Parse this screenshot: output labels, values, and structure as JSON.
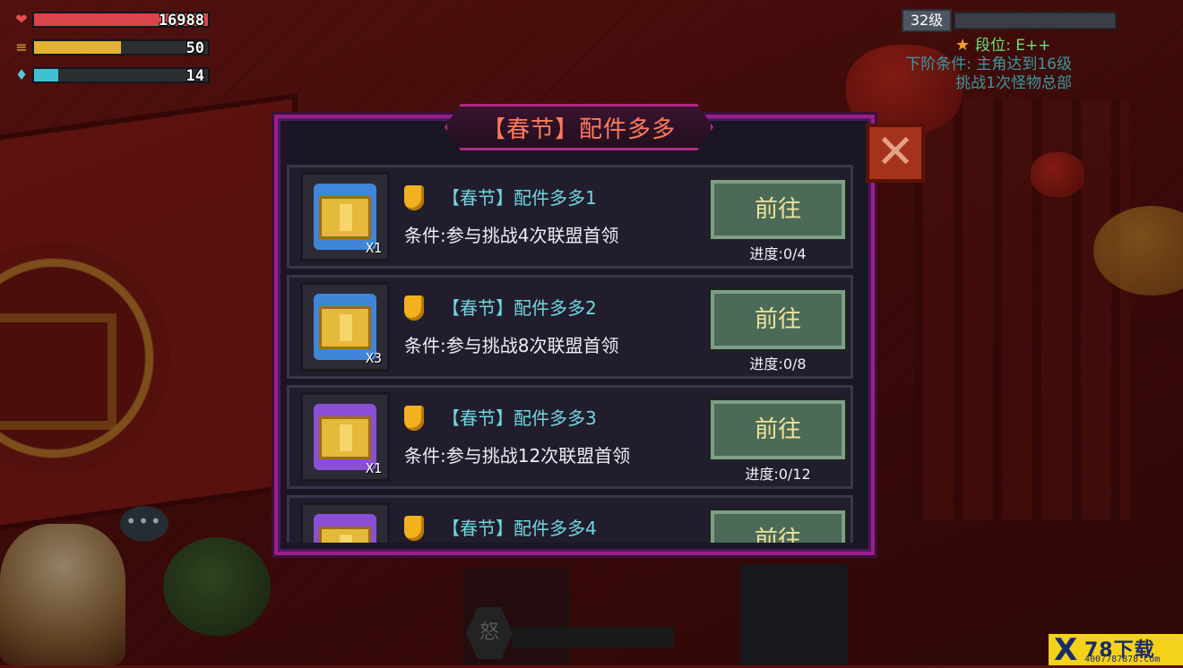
{
  "hud": {
    "stats": [
      {
        "icon": "heart-icon",
        "value": "16988",
        "fill": 1.0,
        "color": "#d9454a"
      },
      {
        "icon": "food-icon",
        "value": "50",
        "fill": 0.5,
        "color": "#e3b133"
      },
      {
        "icon": "water-icon",
        "value": "14",
        "fill": 0.14,
        "color": "#3fc1d3"
      }
    ],
    "level": "32级",
    "rank_label": "段位: E++",
    "next_condition_lines": [
      "下阶条件: 主角达到16级",
      "挑战1次怪物总部"
    ]
  },
  "modal": {
    "title": "【春节】配件多多",
    "close_icon": "close-x-icon",
    "tasks": [
      {
        "name": "【春节】配件多多1",
        "condition": "条件:参与挑战4次联盟首领",
        "button": "前往",
        "progress": "进度:0/4",
        "reward_count": "X1",
        "reward_color": "#3f86d8"
      },
      {
        "name": "【春节】配件多多2",
        "condition": "条件:参与挑战8次联盟首领",
        "button": "前往",
        "progress": "进度:0/8",
        "reward_count": "X3",
        "reward_color": "#3f86d8"
      },
      {
        "name": "【春节】配件多多3",
        "condition": "条件:参与挑战12次联盟首领",
        "button": "前往",
        "progress": "进度:0/12",
        "reward_count": "X1",
        "reward_color": "#8a4fd4"
      },
      {
        "name": "【春节】配件多多4",
        "condition": "",
        "button": "前往",
        "progress": "",
        "reward_count": "",
        "reward_color": "#8a4fd4"
      }
    ]
  },
  "scene": {
    "rage_glyph": "怒",
    "bubble": "•••"
  },
  "watermark": {
    "mark": "X",
    "title": "78下载",
    "phone": "4007787878.com"
  }
}
